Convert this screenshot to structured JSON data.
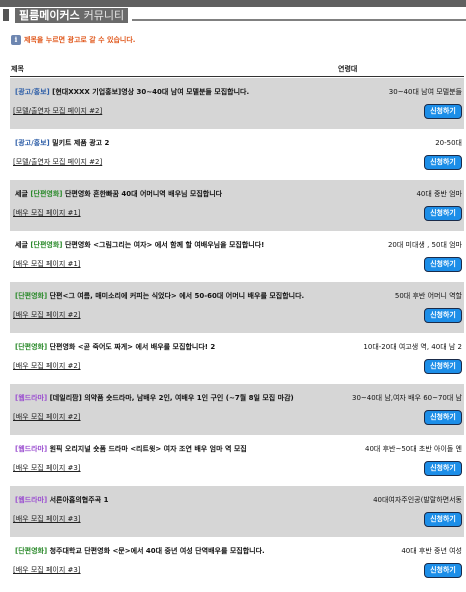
{
  "header": {
    "title": "필름메이커스",
    "subtitle": "커뮤니티"
  },
  "notice": {
    "icon": "info-icon",
    "text": "제목을 누르면 광고로 갈 수 있습니다."
  },
  "columns": {
    "title": "제목",
    "age": "연령대"
  },
  "apply_label": "신청하기",
  "rows": [
    {
      "category": "[광고/홍보]",
      "cat_type": "ad",
      "title": "[현대XXXX 기업홍보]영상 30~40대 남여 모델분들 모집합니다.",
      "sub": "[모델/출연자 모집 페이지 #2]",
      "age": "30~40대 남여 모델분들",
      "gray": true
    },
    {
      "category": "[광고/홍보]",
      "cat_type": "ad",
      "title": "밀키트 제품 광고 2",
      "sub": "[모델/출연자 모집 페이지 #2]",
      "age": "20-50대",
      "gray": false
    },
    {
      "category": "[단편영화]",
      "cat_type": "short",
      "prefix": "세글",
      "title": "단편영화 흔한빠꿈 40대 어머니역 배우님 모집합니다",
      "sub": "[배우 모집 페이지 #1]",
      "age": "40대 중반 엄마",
      "gray": true
    },
    {
      "category": "[단편영화]",
      "cat_type": "short",
      "prefix": "세글",
      "title": "단편영화 <그림그리는 여자> 에서 함께 할 여배우님을 모집합니다!",
      "sub": "[배우 모집 페이지 #1]",
      "age": "20대 미대생 , 50대 엄마",
      "gray": false
    },
    {
      "category": "[단편영화]",
      "cat_type": "short",
      "title": "단편<그 여름, 매미소리에 커피는 식었다> 에서 50-60대 어머니 배우를 모집합니다.",
      "sub": "[배우 모집 페이지 #2]",
      "age": "50대 후반 어머니 역할",
      "gray": true
    },
    {
      "category": "[단편영화]",
      "cat_type": "short",
      "title": "단편영화 <곧 죽어도 짜게> 에서 배우를 모집합니다! 2",
      "sub": "[배우 모집 페이지 #2]",
      "age": "10대-20대 여고생 역, 40대 남 2",
      "gray": false
    },
    {
      "category": "[웹드라마]",
      "cat_type": "web",
      "title": "[데일리팜] 의약품 숏드라마, 남배우 2인, 여배우 1인 구인 (~7월 8일 모집 마감)",
      "sub": "[배우 모집 페이지 #2]",
      "age": "30~40대 남,여자 배우 60~70대 남",
      "gray": true
    },
    {
      "category": "[웹드라마]",
      "cat_type": "web",
      "title": "원픽 오리지널 숏폼 드라마 <리트윗> 여자 조연 배우 엄마 역 모집",
      "sub": "[배우 모집 페이지 #3]",
      "age": "40대 후반~50대 초반 아이돌 엔",
      "gray": false
    },
    {
      "category": "[웹드라마]",
      "cat_type": "web",
      "title": "서른아홉의협주곡 1",
      "sub": "[배우 모집 페이지 #3]",
      "age": "40대여자주인공(발랄하면서동",
      "gray": true
    },
    {
      "category": "[단편영화]",
      "cat_type": "short",
      "title": "청주대학교 단편영화 <문>에서 40대 중년 여성 단역배우를 모집합니다.",
      "sub": "[배우 모집 페이지 #3]",
      "age": "40대 후반 중년 여성",
      "gray": false
    }
  ]
}
